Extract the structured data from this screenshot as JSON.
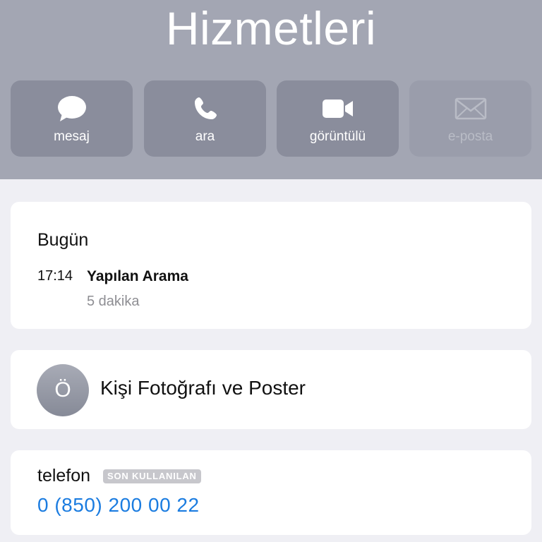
{
  "header": {
    "name": "Hizmetleri",
    "background": "#a3a6b3"
  },
  "actions": [
    {
      "label": "mesaj",
      "icon": "message-bubble-icon",
      "enabled": true
    },
    {
      "label": "ara",
      "icon": "phone-icon",
      "enabled": true
    },
    {
      "label": "görüntülü",
      "icon": "video-camera-icon",
      "enabled": true
    },
    {
      "label": "e-posta",
      "icon": "envelope-icon",
      "enabled": false
    }
  ],
  "recents": {
    "title": "Bugün",
    "items": [
      {
        "time": "17:14",
        "type": "Yapılan Arama",
        "duration": "5 dakika"
      }
    ]
  },
  "photo": {
    "avatar_letter": "Ö",
    "label": "Kişi Fotoğrafı ve Poster"
  },
  "phone": {
    "label": "telefon",
    "badge": "SON KULLANILAN",
    "number": "0 (850) 200 00 22",
    "link_color": "#1b7ce0"
  }
}
